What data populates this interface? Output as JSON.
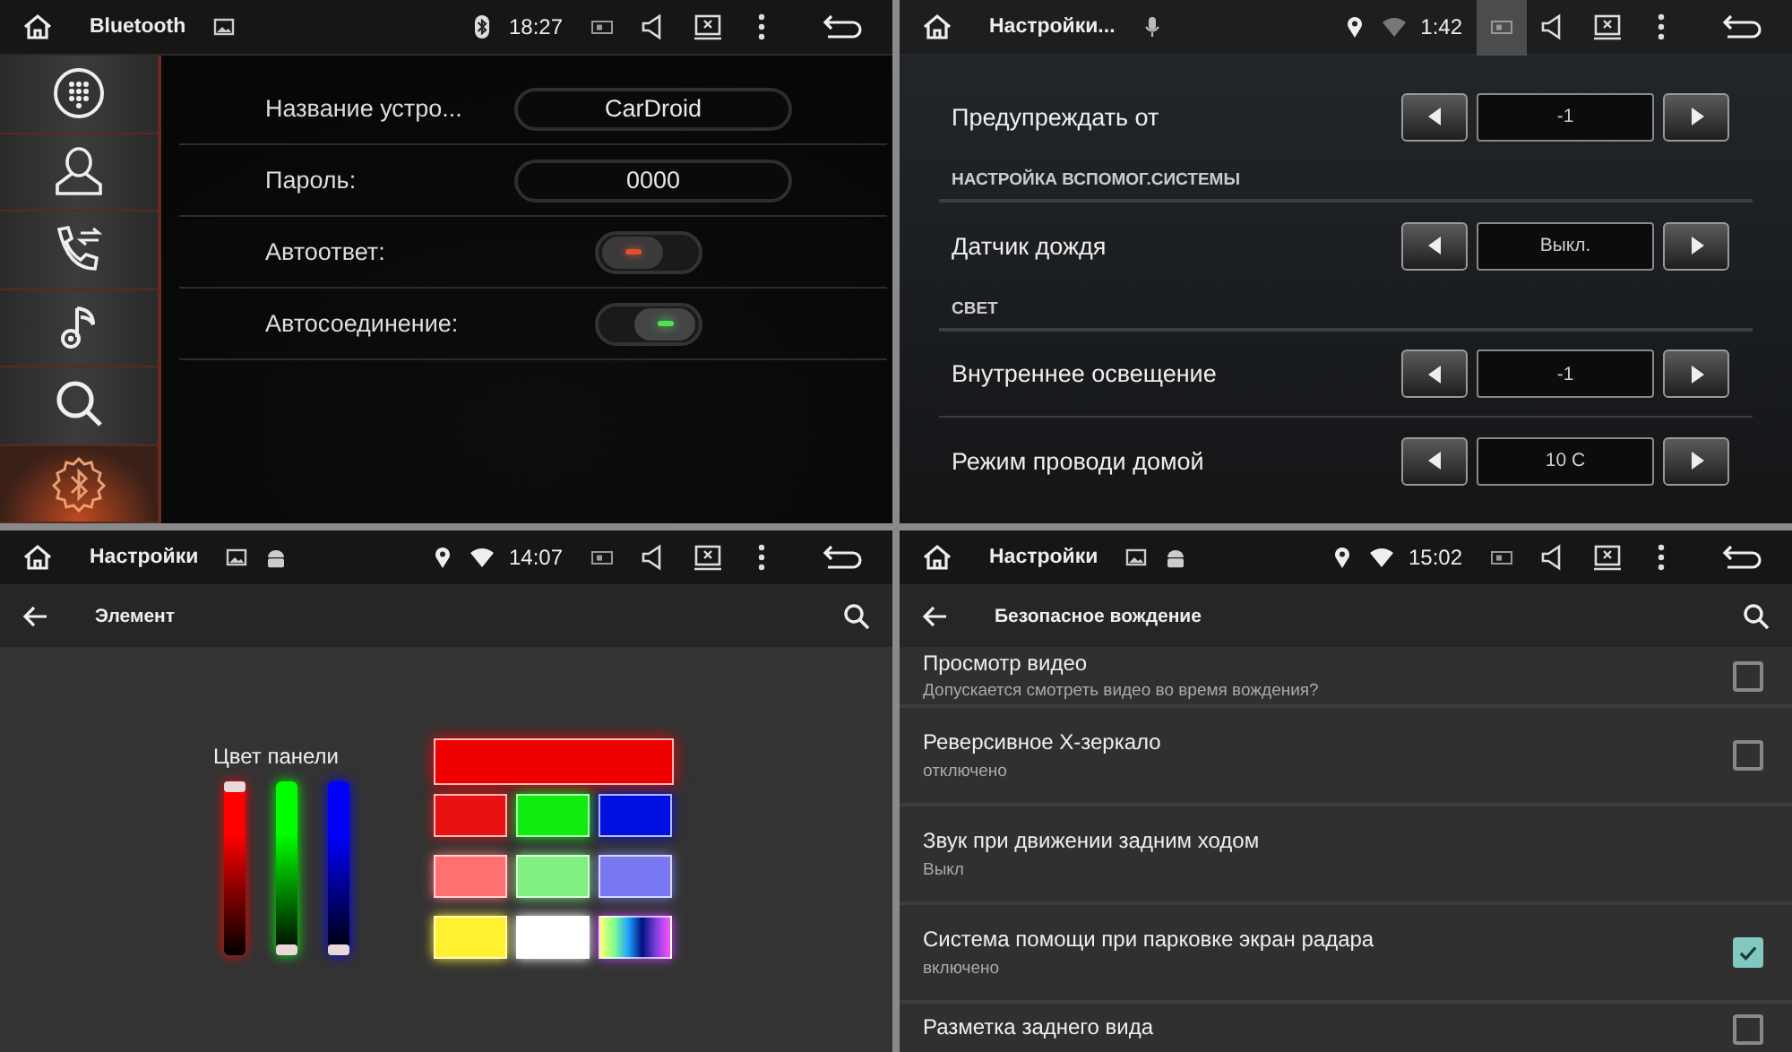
{
  "bluetooth_screen": {
    "status_bar": {
      "title": "Bluetooth",
      "time": "18:27",
      "screen_button_pressed": false
    },
    "sidebar": [
      {
        "selected": false
      },
      {
        "selected": false
      },
      {
        "selected": false
      },
      {
        "selected": false
      },
      {
        "selected": false
      },
      {
        "selected": true
      }
    ],
    "rows": [
      {
        "kind": "field",
        "label": "Название устро...",
        "value": "CarDroid"
      },
      {
        "kind": "field",
        "label": "Пароль:",
        "value": "0000"
      },
      {
        "kind": "toggle",
        "label": "Автоответ:",
        "on": false
      },
      {
        "kind": "toggle",
        "label": "Автосоединение:",
        "on": true
      }
    ]
  },
  "vehicle_settings_screen": {
    "status_bar": {
      "title": "Настройки...",
      "time": "1:42",
      "screen_button_pressed": true
    },
    "items": [
      {
        "kind": "stepper",
        "label": "Предупреждать от",
        "value": "-1"
      },
      {
        "kind": "header",
        "label": "НАСТРОЙКА ВСПОМОГ.СИСТЕМЫ"
      },
      {
        "kind": "stepper",
        "label": "Датчик дождя",
        "value": "Выкл."
      },
      {
        "kind": "header",
        "label": "СВЕТ"
      },
      {
        "kind": "stepper",
        "label": "Внутреннее освещение",
        "value": "-1"
      },
      {
        "kind": "stepper",
        "label": "Режим проводи домой",
        "value": "10 C"
      }
    ]
  },
  "color_screen": {
    "status_bar": {
      "title": "Настройки",
      "time": "14:07",
      "screen_button_pressed": false
    },
    "toolbar": {
      "title": "Элемент"
    },
    "label": "Цвет панели",
    "sliders": [
      {
        "color": "#ff0000",
        "level": 1
      },
      {
        "color": "#00ff00",
        "level": 0
      },
      {
        "color": "#0000ff",
        "level": 0
      }
    ],
    "preview": {
      "color": "#ee0000"
    },
    "swatches": [
      {
        "kind": "solid",
        "color": "#e81010"
      },
      {
        "kind": "solid",
        "color": "#10ee10"
      },
      {
        "kind": "solid",
        "color": "#0010e0"
      },
      {
        "kind": "solid",
        "color": "#ff7070"
      },
      {
        "kind": "solid",
        "color": "#80f080"
      },
      {
        "kind": "solid",
        "color": "#7878f0"
      },
      {
        "kind": "solid",
        "color": "#fff030"
      },
      {
        "kind": "solid",
        "color": "#ffffff"
      },
      {
        "kind": "spectrum"
      }
    ]
  },
  "safe_driving_screen": {
    "status_bar": {
      "title": "Настройки",
      "time": "15:02",
      "screen_button_pressed": false
    },
    "toolbar": {
      "title": "Безопасное вождение"
    },
    "items": [
      {
        "kind": "checkbox",
        "title": "Просмотр видео",
        "summary": "Допускается смотреть видео во время вождения?",
        "checked": false
      },
      {
        "kind": "checkbox",
        "title": "Реверсивное X-зеркало",
        "summary": "отключено",
        "checked": false
      },
      {
        "kind": "text",
        "title": "Звук при движении задним ходом",
        "summary": "Выкл"
      },
      {
        "kind": "checkbox",
        "title": "Система помощи при парковке экран радара",
        "summary": "включено",
        "checked": true
      },
      {
        "kind": "checkbox",
        "title": "Разметка заднего вида",
        "checked": false
      }
    ]
  }
}
